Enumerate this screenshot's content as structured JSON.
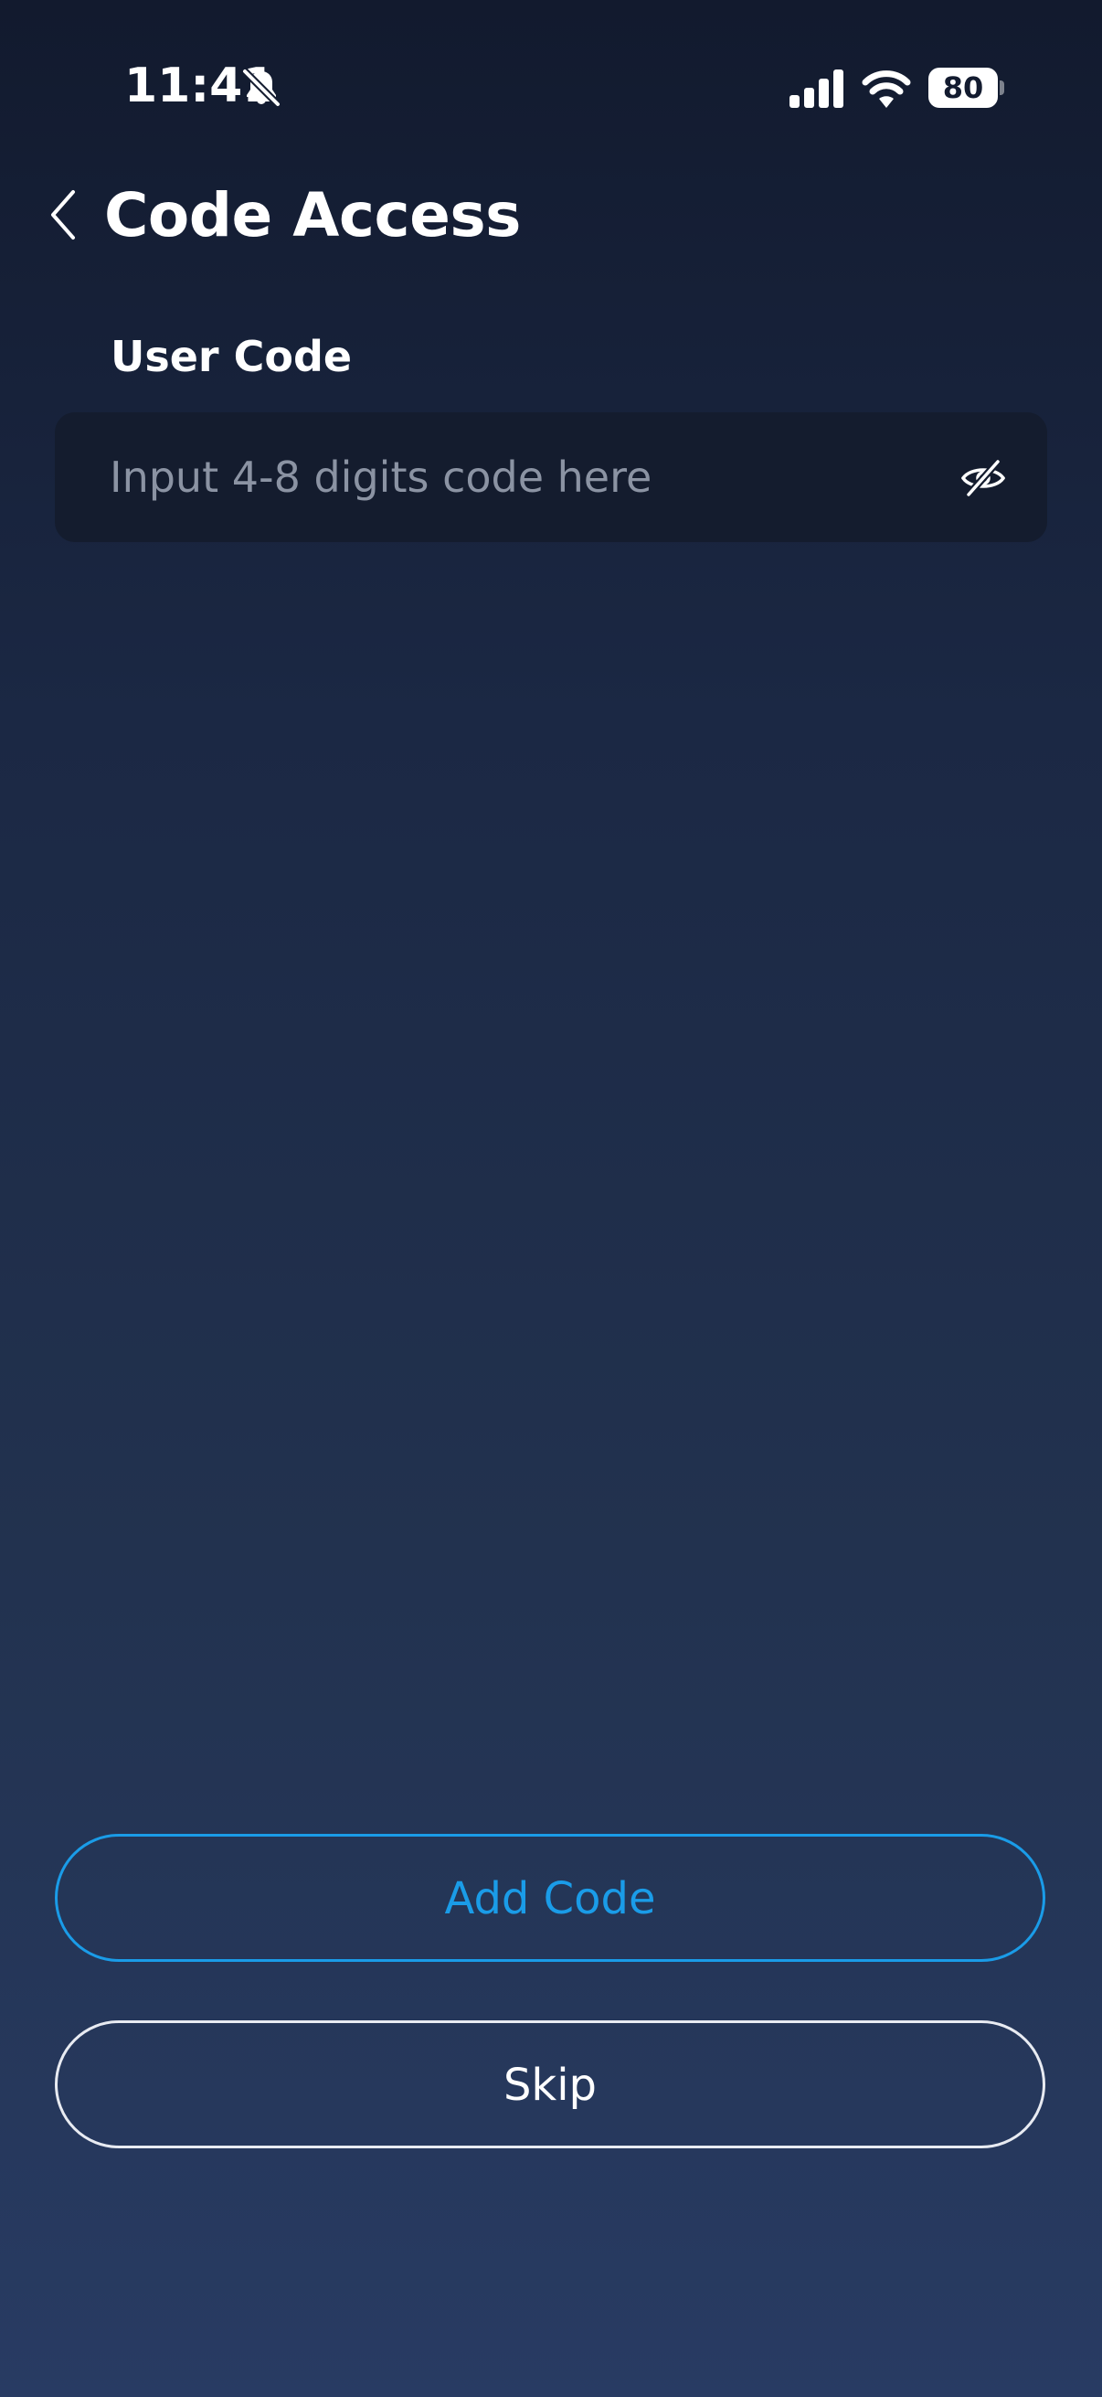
{
  "status_bar": {
    "time": "11:41",
    "battery_level": "80",
    "icons": [
      "bell-slash-icon",
      "cellular-signal-icon",
      "wifi-icon",
      "battery-icon"
    ]
  },
  "header": {
    "title": "Code Access",
    "back_icon": "chevron-left-icon"
  },
  "form": {
    "label": "User Code",
    "input": {
      "value": "",
      "placeholder": "Input 4-8 digits code here",
      "toggle_icon": "eye-slash-icon"
    }
  },
  "actions": {
    "add_label": "Add Code",
    "skip_label": "Skip"
  },
  "colors": {
    "accent": "#1a9ce8",
    "field_bg": "#141c2e",
    "background_top": "#121a2e",
    "background_bottom": "#283b63"
  }
}
